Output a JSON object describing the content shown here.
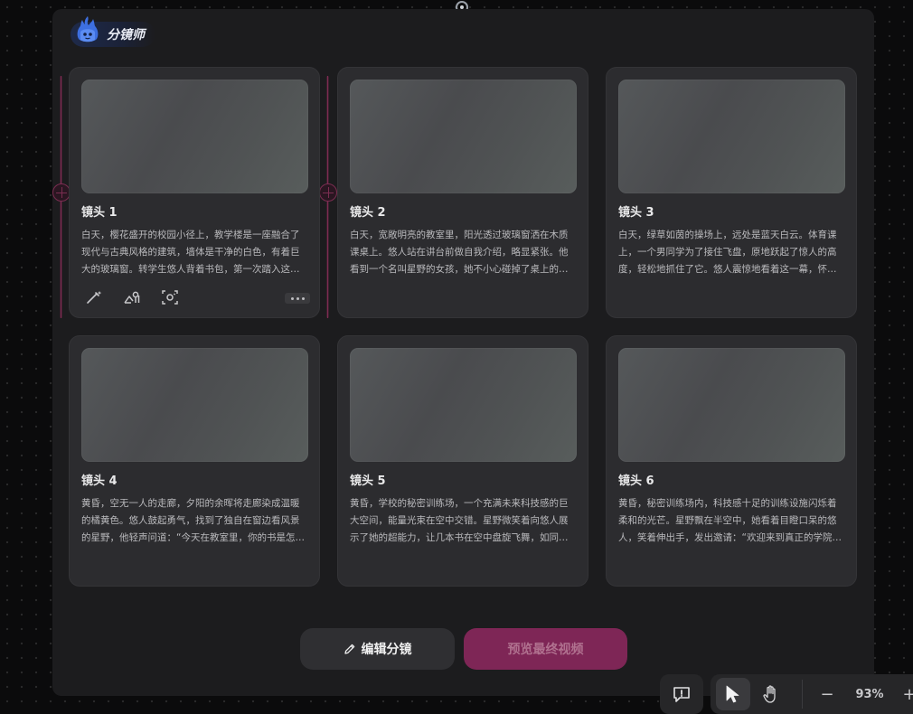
{
  "agent": {
    "name": "分镜师",
    "avatar_icon": "flame-ghost-icon"
  },
  "shots": [
    {
      "title": "镜头 1",
      "description": "白天，樱花盛开的校园小径上，教学楼是一座融合了现代与古典风格的建筑，墙体是干净的白色，有着巨大的玻璃窗。转学生悠人背着书包，第一次踏入这所学校，四处张望着。"
    },
    {
      "title": "镜头 2",
      "description": "白天，宽敞明亮的教室里，阳光透过玻璃窗洒在木质课桌上。悠人站在讲台前做自我介绍，略显紧张。他看到一个名叫星野的女孩，她不小心碰掉了桌上的书本。"
    },
    {
      "title": "镜头 3",
      "description": "白天，绿草如茵的操场上，远处是蓝天白云。体育课上，一个男同学为了接住飞盘，原地跃起了惊人的高度，轻松地抓住了它。悠人震惊地看着这一幕，怀疑自己看错了。"
    },
    {
      "title": "镜头 4",
      "description": "黄昏，空无一人的走廊，夕阳的余晖将走廊染成温暖的橘黄色。悠人鼓起勇气，找到了独自在窗边看风景的星野，他轻声问道：“今天在教室里，你的书是怎么回事？”"
    },
    {
      "title": "镜头 5",
      "description": "黄昏，学校的秘密训练场，一个充满未来科技感的巨大空间，能量光束在空中交错。星野微笑着向悠人展示了她的超能力，让几本书在空中盘旋飞舞，如同有了生命。"
    },
    {
      "title": "镜头 6",
      "description": "黄昏，秘密训练场内，科技感十足的训练设施闪烁着柔和的光芒。星野飘在半空中，她看着目瞪口呆的悠人，笑着伸出手，发出邀请：“欢迎来到真正的学院，你也拥有能力哦。”"
    }
  ],
  "card_tools": {
    "icons": [
      "magic-wand-icon",
      "image-location-icon",
      "camera-frame-icon",
      "more-icon"
    ]
  },
  "actions": {
    "edit_label": "编辑分镜",
    "edit_icon": "pencil-icon",
    "preview_label": "预览最终视频"
  },
  "toolbar": {
    "feedback_icon": "feedback-icon",
    "select_icon": "cursor-icon",
    "hand_icon": "hand-icon",
    "zoom_out": "−",
    "zoom": "93%",
    "zoom_in": "+"
  },
  "colors": {
    "accent": "#7e2656",
    "link": "#7b2d51",
    "panel": "#1c1c1e",
    "card": "#2c2c2f"
  }
}
